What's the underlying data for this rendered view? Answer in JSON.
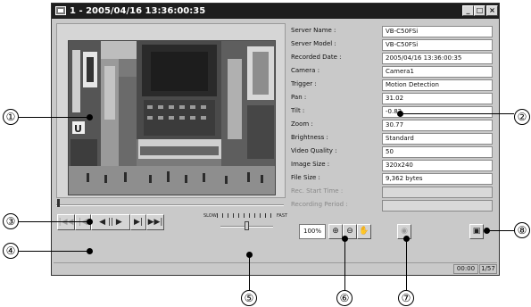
{
  "window": {
    "title": "1 - 2005/04/16 13:36:00:35",
    "minimize_glyph": "_",
    "maximize_glyph": "□",
    "close_glyph": "×"
  },
  "info": [
    {
      "label": "Server Name :",
      "value": "VB-C50FSi",
      "enabled": true
    },
    {
      "label": "Server Model :",
      "value": "VB-C50FSi",
      "enabled": true
    },
    {
      "label": "Recorded Date :",
      "value": "2005/04/16 13:36:00:35",
      "enabled": true
    },
    {
      "label": "Camera :",
      "value": "Camera1",
      "enabled": true
    },
    {
      "label": "Trigger :",
      "value": "Motion Detection",
      "enabled": true
    },
    {
      "label": "Pan :",
      "value": "31.02",
      "enabled": true
    },
    {
      "label": "Tilt :",
      "value": "-0.82",
      "enabled": true
    },
    {
      "label": "Zoom :",
      "value": "30.77",
      "enabled": true
    },
    {
      "label": "Brightness :",
      "value": "Standard",
      "enabled": true
    },
    {
      "label": "Video Quality :",
      "value": "50",
      "enabled": true
    },
    {
      "label": "Image Size :",
      "value": "320x240",
      "enabled": true
    },
    {
      "label": "File Size :",
      "value": "9,362 bytes",
      "enabled": true
    },
    {
      "label": "Rec. Start Time :",
      "value": "",
      "enabled": false
    },
    {
      "label": "Recording Period :",
      "value": "",
      "enabled": false
    }
  ],
  "seek": {
    "position": 0.0
  },
  "transport": {
    "first": "|◀◀",
    "prev": "|◀",
    "play_reverse_pause_play": "◀ || ▶",
    "next": "▶|",
    "last": "▶▶|"
  },
  "speed": {
    "slow_label": "SLOW",
    "fast_label": "FAST",
    "level": 0.5
  },
  "zoom": {
    "value": "100%",
    "zoom_in_glyph": "⊕",
    "zoom_out_glyph": "⊖",
    "hand_glyph": "✋"
  },
  "capture_glyph": "◉",
  "display_button_glyph": "▣",
  "status": {
    "time": "00:00",
    "count": "1/57"
  },
  "callouts": [
    "①",
    "②",
    "③",
    "④",
    "⑤",
    "⑥",
    "⑦",
    "⑧"
  ],
  "colors": {
    "titlebar": "#1e1e1e",
    "window": "#c9c9c9",
    "field": "#ffffff"
  }
}
